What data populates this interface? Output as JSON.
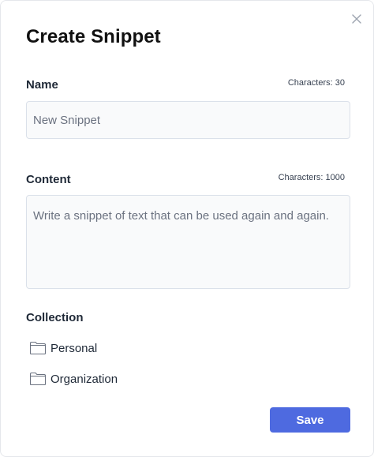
{
  "dialog": {
    "title": "Create Snippet",
    "close_icon": "close-icon"
  },
  "name_field": {
    "label": "Name",
    "char_limit": "Characters: 30",
    "value": "",
    "placeholder": "New Snippet"
  },
  "content_field": {
    "label": "Content",
    "char_limit": "Characters: 1000",
    "value": "",
    "placeholder": "Write a snippet of text that can be used again and again."
  },
  "collection": {
    "label": "Collection",
    "items": [
      {
        "label": "Personal",
        "icon": "folder-icon"
      },
      {
        "label": "Organization",
        "icon": "folder-icon"
      }
    ]
  },
  "actions": {
    "save_label": "Save"
  },
  "colors": {
    "accent": "#4e6ae0",
    "input_bg": "#f9fafb",
    "input_border": "#dbe1ea"
  }
}
